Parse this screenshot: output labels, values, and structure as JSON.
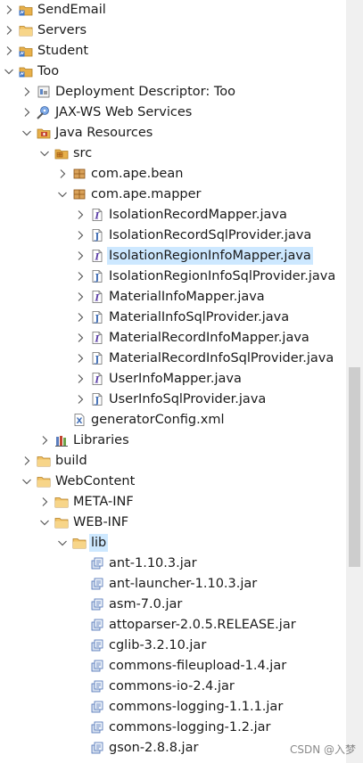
{
  "tree": {
    "rows": [
      {
        "label": "SendEmail",
        "icon": "project-icon",
        "twisty": "collapsed",
        "depth": 0
      },
      {
        "label": "Servers",
        "icon": "folder-icon",
        "twisty": "collapsed",
        "depth": 0
      },
      {
        "label": "Student",
        "icon": "project-icon",
        "twisty": "collapsed",
        "depth": 0
      },
      {
        "label": "Too",
        "icon": "project-icon",
        "twisty": "expanded",
        "depth": 0
      },
      {
        "label": "Deployment Descriptor: Too",
        "icon": "deployment-descriptor-icon",
        "twisty": "collapsed",
        "depth": 1
      },
      {
        "label": "JAX-WS Web Services",
        "icon": "web-services-icon",
        "twisty": "collapsed",
        "depth": 1
      },
      {
        "label": "Java Resources",
        "icon": "java-resources-icon",
        "twisty": "expanded",
        "depth": 1
      },
      {
        "label": "src",
        "icon": "source-folder-icon",
        "twisty": "expanded",
        "depth": 2
      },
      {
        "label": "com.ape.bean",
        "icon": "package-icon",
        "twisty": "collapsed",
        "depth": 3
      },
      {
        "label": "com.ape.mapper",
        "icon": "package-icon",
        "twisty": "expanded",
        "depth": 3
      },
      {
        "label": "IsolationRecordMapper.java",
        "icon": "java-interface-icon",
        "twisty": "collapsed",
        "depth": 4
      },
      {
        "label": "IsolationRecordSqlProvider.java",
        "icon": "java-file-icon",
        "twisty": "collapsed",
        "depth": 4
      },
      {
        "label": "IsolationRegionInfoMapper.java",
        "icon": "java-interface-icon",
        "twisty": "collapsed",
        "depth": 4,
        "selected": true
      },
      {
        "label": "IsolationRegionInfoSqlProvider.java",
        "icon": "java-file-icon",
        "twisty": "collapsed",
        "depth": 4
      },
      {
        "label": "MaterialInfoMapper.java",
        "icon": "java-interface-icon",
        "twisty": "collapsed",
        "depth": 4
      },
      {
        "label": "MaterialInfoSqlProvider.java",
        "icon": "java-file-icon",
        "twisty": "collapsed",
        "depth": 4
      },
      {
        "label": "MaterialRecordInfoMapper.java",
        "icon": "java-interface-icon",
        "twisty": "collapsed",
        "depth": 4
      },
      {
        "label": "MaterialRecordInfoSqlProvider.java",
        "icon": "java-file-icon",
        "twisty": "collapsed",
        "depth": 4
      },
      {
        "label": "UserInfoMapper.java",
        "icon": "java-interface-icon",
        "twisty": "collapsed",
        "depth": 4
      },
      {
        "label": "UserInfoSqlProvider.java",
        "icon": "java-file-icon",
        "twisty": "collapsed",
        "depth": 4
      },
      {
        "label": "generatorConfig.xml",
        "icon": "xml-file-icon",
        "twisty": "none",
        "depth": 3
      },
      {
        "label": "Libraries",
        "icon": "libraries-icon",
        "twisty": "collapsed",
        "depth": 2
      },
      {
        "label": "build",
        "icon": "folder-icon",
        "twisty": "collapsed",
        "depth": 1
      },
      {
        "label": "WebContent",
        "icon": "folder-icon",
        "twisty": "expanded",
        "depth": 1
      },
      {
        "label": "META-INF",
        "icon": "folder-icon",
        "twisty": "collapsed",
        "depth": 2
      },
      {
        "label": "WEB-INF",
        "icon": "folder-icon",
        "twisty": "expanded",
        "depth": 2
      },
      {
        "label": "lib",
        "icon": "folder-icon",
        "twisty": "expanded",
        "depth": 3,
        "selected": true
      },
      {
        "label": "ant-1.10.3.jar",
        "icon": "jar-icon",
        "twisty": "none",
        "depth": 4
      },
      {
        "label": "ant-launcher-1.10.3.jar",
        "icon": "jar-icon",
        "twisty": "none",
        "depth": 4
      },
      {
        "label": "asm-7.0.jar",
        "icon": "jar-icon",
        "twisty": "none",
        "depth": 4
      },
      {
        "label": "attoparser-2.0.5.RELEASE.jar",
        "icon": "jar-icon",
        "twisty": "none",
        "depth": 4
      },
      {
        "label": "cglib-3.2.10.jar",
        "icon": "jar-icon",
        "twisty": "none",
        "depth": 4
      },
      {
        "label": "commons-fileupload-1.4.jar",
        "icon": "jar-icon",
        "twisty": "none",
        "depth": 4
      },
      {
        "label": "commons-io-2.4.jar",
        "icon": "jar-icon",
        "twisty": "none",
        "depth": 4
      },
      {
        "label": "commons-logging-1.1.1.jar",
        "icon": "jar-icon",
        "twisty": "none",
        "depth": 4
      },
      {
        "label": "commons-logging-1.2.jar",
        "icon": "jar-icon",
        "twisty": "none",
        "depth": 4
      },
      {
        "label": "gson-2.8.8.jar",
        "icon": "jar-icon",
        "twisty": "none",
        "depth": 4
      }
    ]
  },
  "watermark": "CSDN @入梦",
  "colors": {
    "selection": "#cde8ff",
    "folder": "#e8b04a",
    "java_blue": "#4a6fb5"
  }
}
